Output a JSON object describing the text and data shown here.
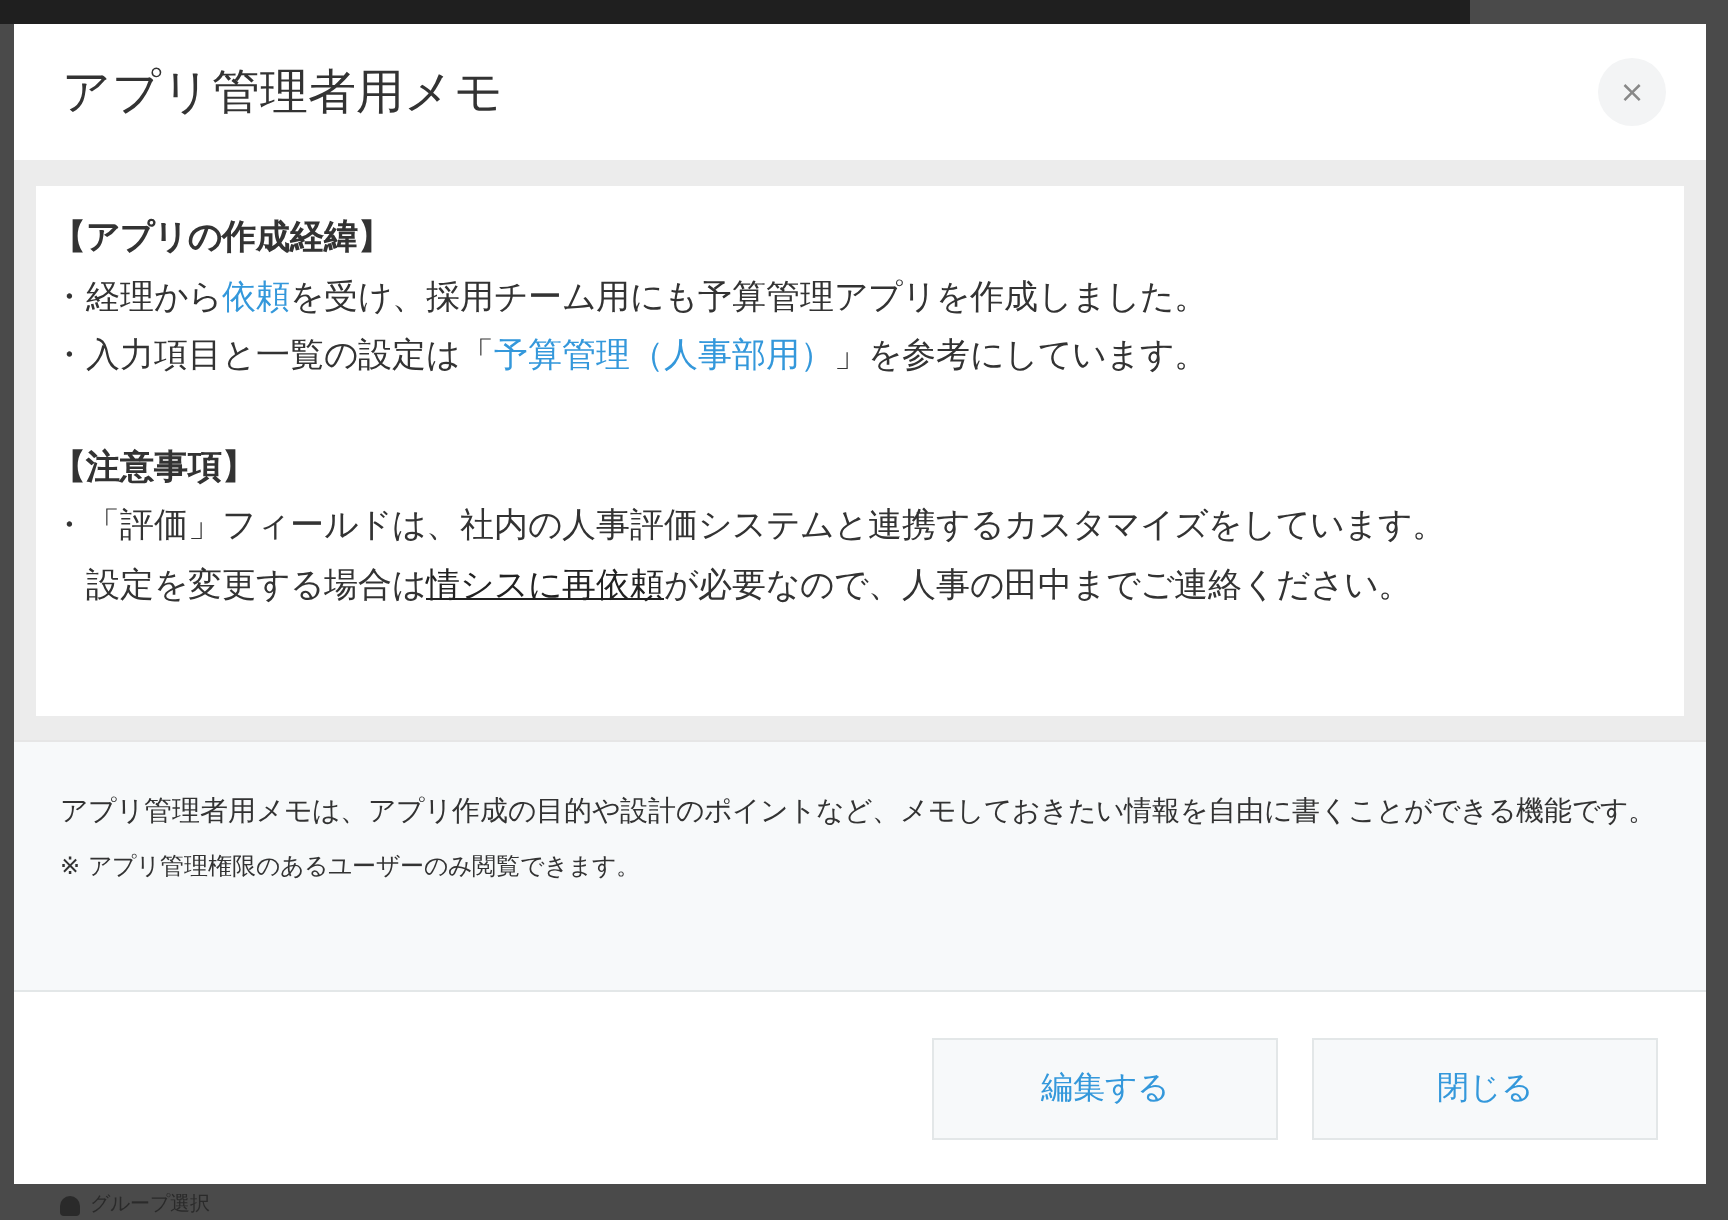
{
  "dialog": {
    "title": "アプリ管理者用メモ",
    "close": "×"
  },
  "memo": {
    "lines": [
      {
        "kind": "heading",
        "segments": [
          {
            "kind": "plain",
            "text": "【アプリの作成経緯】"
          }
        ]
      },
      {
        "kind": "bullet",
        "segments": [
          {
            "kind": "plain",
            "text": "・経理から"
          },
          {
            "kind": "link",
            "text": "依頼"
          },
          {
            "kind": "plain",
            "text": "を受け、採用チーム用にも予算管理アプリを作成しました。"
          }
        ]
      },
      {
        "kind": "bullet",
        "segments": [
          {
            "kind": "plain",
            "text": "・入力項目と一覧の設定は「"
          },
          {
            "kind": "link",
            "text": "予算管理（人事部用）"
          },
          {
            "kind": "plain",
            "text": "」を参考にしています。"
          }
        ]
      },
      {
        "kind": "blank"
      },
      {
        "kind": "heading",
        "segments": [
          {
            "kind": "plain",
            "text": "【注意事項】"
          }
        ]
      },
      {
        "kind": "bullet",
        "segments": [
          {
            "kind": "plain",
            "text": "・「評価」フィールドは、社内の人事評価システムと連携するカスタマイズをしています。"
          }
        ]
      },
      {
        "kind": "continuation",
        "segments": [
          {
            "kind": "plain",
            "text": "設定を変更する場合は"
          },
          {
            "kind": "underline",
            "text": "情シスに再依頼"
          },
          {
            "kind": "plain",
            "text": "が必要なので、人事の田中までご連絡ください。"
          }
        ]
      }
    ]
  },
  "info": {
    "description": "アプリ管理者用メモは、アプリ作成の目的や設計のポイントなど、メモしておきたい情報を自由に書くことができる機能です。",
    "note": "※ アプリ管理権限のあるユーザーのみ閲覧できます。"
  },
  "buttons": [
    {
      "label": "編集する"
    },
    {
      "label": "閉じる"
    }
  ],
  "background": {
    "group_select": "グループ選択"
  }
}
